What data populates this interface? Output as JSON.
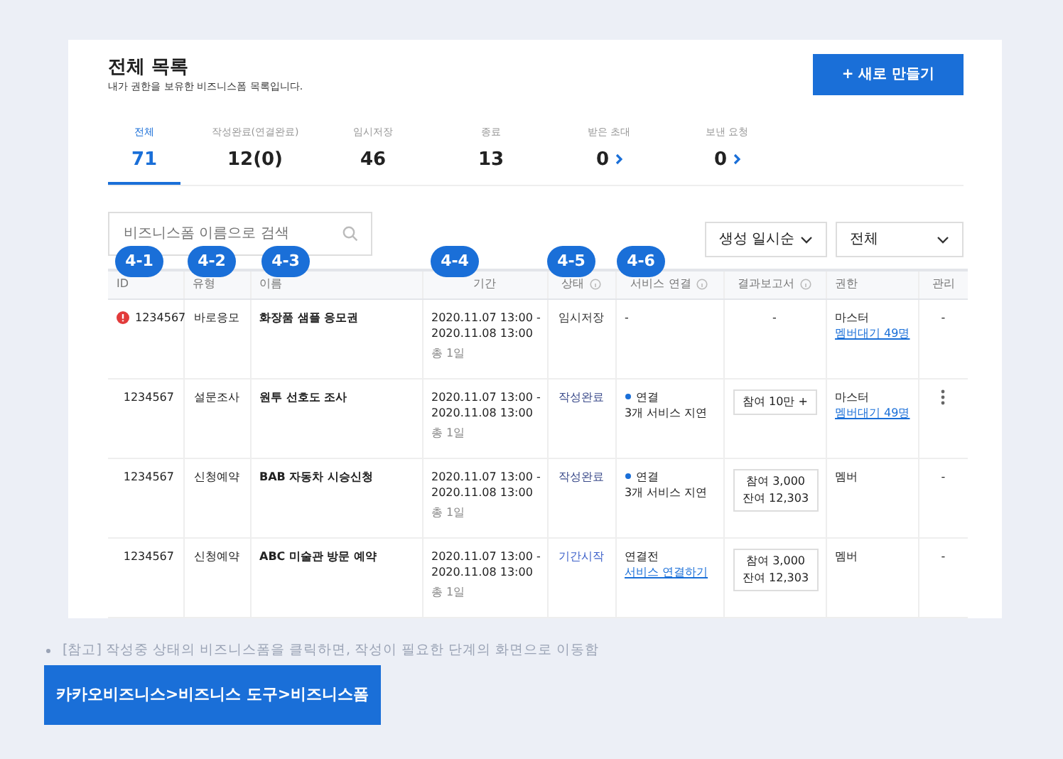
{
  "page": {
    "title": "전체 목록",
    "subtitle": "내가 권한을 보유한 비즈니스폼 목록입니다.",
    "create_button": "+ 새로 만들기"
  },
  "tabs": [
    {
      "label": "전체",
      "count": "71",
      "selected": true,
      "arrow": false
    },
    {
      "label": "작성완료(연결완료)",
      "count": "12(0)",
      "selected": false,
      "arrow": false
    },
    {
      "label": "임시저장",
      "count": "46",
      "selected": false,
      "arrow": false
    },
    {
      "label": "종료",
      "count": "13",
      "selected": false,
      "arrow": false
    },
    {
      "label": "받은 초대",
      "count": "0",
      "selected": false,
      "arrow": true
    },
    {
      "label": "보낸 요청",
      "count": "0",
      "selected": false,
      "arrow": true
    }
  ],
  "search": {
    "placeholder": "비즈니스폼 이름으로 검색"
  },
  "markers": [
    "4-1",
    "4-2",
    "4-3",
    "4-4",
    "4-5",
    "4-6"
  ],
  "filters": [
    "생성 일시순",
    "전체"
  ],
  "table": {
    "columns": [
      {
        "label": "ID",
        "info": false
      },
      {
        "label": "유형",
        "info": false
      },
      {
        "label": "이름",
        "info": false
      },
      {
        "label": "기간",
        "info": false
      },
      {
        "label": "상태",
        "info": true
      },
      {
        "label": "서비스 연결",
        "info": true
      },
      {
        "label": "결과보고서",
        "info": true
      },
      {
        "label": "권한",
        "info": false
      },
      {
        "label": "관리",
        "info": false
      }
    ],
    "rows": [
      {
        "alert": true,
        "id": "1234567",
        "type": "바로응모",
        "name": "화장품 샘플 응모권",
        "period": [
          "2020.11.07 13:00 -",
          "2020.11.08 13:00"
        ],
        "duration": "총 1일",
        "status": {
          "text": "임시저장",
          "color": "#333333"
        },
        "service": {
          "kind": "none",
          "text": "-"
        },
        "result": {
          "kind": "none",
          "lines": [
            "-"
          ]
        },
        "role": "마스터",
        "role_link": "멤버대기 49명",
        "manage": {
          "kind": "none",
          "text": "-"
        }
      },
      {
        "alert": false,
        "id": "1234567",
        "type": "설문조사",
        "name": "원투 선호도 조사",
        "period": [
          "2020.11.07 13:00 -",
          "2020.11.08 13:00"
        ],
        "duration": "총 1일",
        "status": {
          "text": "작성완료",
          "color": "#3a4a8a"
        },
        "service": {
          "kind": "connected",
          "text": "연결",
          "sub": "3개 서비스 지연"
        },
        "result": {
          "kind": "box",
          "lines": [
            "참여 10만 +"
          ]
        },
        "role": "마스터",
        "role_link": "멤버대기 49명",
        "manage": {
          "kind": "menu"
        }
      },
      {
        "alert": false,
        "id": "1234567",
        "type": "신청예약",
        "name": "BAB 자동차 시승신청",
        "period": [
          "2020.11.07 13:00 -",
          "2020.11.08 13:00"
        ],
        "duration": "총 1일",
        "status": {
          "text": "작성완료",
          "color": "#3a4a8a"
        },
        "service": {
          "kind": "connected",
          "text": "연결",
          "sub": "3개 서비스 지연"
        },
        "result": {
          "kind": "box",
          "lines": [
            "참여 3,000",
            "잔여 12,303"
          ]
        },
        "role": "멤버",
        "manage": {
          "kind": "none",
          "text": "-"
        }
      },
      {
        "alert": false,
        "id": "1234567",
        "type": "신청예약",
        "name": "ABC 미술관 방문 예약",
        "period": [
          "2020.11.07 13:00 -",
          "2020.11.08 13:00"
        ],
        "duration": "총 1일",
        "status": {
          "text": "기간시작",
          "color": "#3b5fc9"
        },
        "service": {
          "kind": "unconnected",
          "text": "연결전",
          "link": "서비스 연결하기"
        },
        "result": {
          "kind": "box",
          "lines": [
            "참여 3,000",
            "잔여 12,303"
          ]
        },
        "role": "멤버",
        "manage": {
          "kind": "none",
          "text": "-"
        }
      }
    ]
  },
  "note": "[참고] 작성중 상태의 비즈니스폼을 클릭하면, 작성이 필요한 단계의 화면으로 이동함",
  "path_button": "카카오비즈니스>비즈니스 도구>비즈니스폼"
}
